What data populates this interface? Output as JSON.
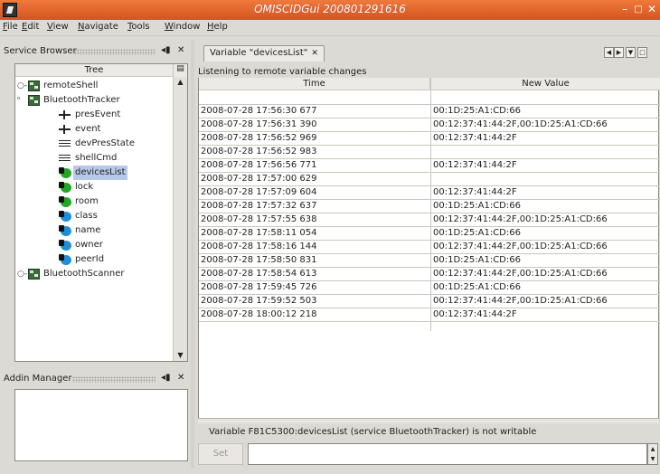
{
  "window": {
    "title": "OMISCIDGui 200801291616"
  },
  "menu": [
    "File",
    "Edit",
    "View",
    "Navigate",
    "Tools",
    "Window",
    "Help"
  ],
  "service_browser": {
    "title": "Service Browser",
    "column": "Tree",
    "pin": "◂▮",
    "close": "✕",
    "items": [
      {
        "label": "remoteShell",
        "type": "service",
        "expanded": false,
        "indent": 0
      },
      {
        "label": "BluetoothTracker",
        "type": "service",
        "expanded": true,
        "indent": 0
      },
      {
        "label": "presEvent",
        "type": "event",
        "indent": 1
      },
      {
        "label": "event",
        "type": "event",
        "indent": 1
      },
      {
        "label": "devPresState",
        "type": "command",
        "indent": 1
      },
      {
        "label": "shellCmd",
        "type": "command",
        "indent": 1
      },
      {
        "label": "devicesList",
        "type": "variable",
        "color": "#22a722",
        "indent": 1,
        "selected": true
      },
      {
        "label": "lock",
        "type": "variable",
        "color": "#22a722",
        "indent": 1
      },
      {
        "label": "room",
        "type": "variable",
        "color": "#22a722",
        "indent": 1
      },
      {
        "label": "class",
        "type": "variable",
        "color": "#1e8fd8",
        "indent": 1
      },
      {
        "label": "name",
        "type": "variable",
        "color": "#1e8fd8",
        "indent": 1
      },
      {
        "label": "owner",
        "type": "variable",
        "color": "#1e8fd8",
        "indent": 1
      },
      {
        "label": "peerId",
        "type": "variable",
        "color": "#1e8fd8",
        "indent": 1
      },
      {
        "label": "BluetoothScanner",
        "type": "service",
        "expanded": false,
        "indent": 0
      }
    ]
  },
  "addin_manager": {
    "title": "Addin Manager",
    "pin": "◂▮",
    "close": "✕"
  },
  "tab": {
    "label": "Variable \"devicesList\"",
    "close": "✕"
  },
  "listening_label": "Listening to remote variable changes",
  "table": {
    "columns": [
      "Time",
      "New Value"
    ],
    "rows": [
      [
        "",
        ""
      ],
      [
        "2008-07-28 17:56:30 677",
        "00:1D:25:A1:CD:66"
      ],
      [
        "2008-07-28 17:56:31 390",
        "00:12:37:41:44:2F,00:1D:25:A1:CD:66"
      ],
      [
        "2008-07-28 17:56:52 969",
        "00:12:37:41:44:2F"
      ],
      [
        "2008-07-28 17:56:52 983",
        ""
      ],
      [
        "2008-07-28 17:56:56 771",
        "00:12:37:41:44:2F"
      ],
      [
        "2008-07-28 17:57:00 629",
        ""
      ],
      [
        "2008-07-28 17:57:09 604",
        "00:12:37:41:44:2F"
      ],
      [
        "2008-07-28 17:57:32 637",
        "00:1D:25:A1:CD:66"
      ],
      [
        "2008-07-28 17:57:55 638",
        "00:12:37:41:44:2F,00:1D:25:A1:CD:66"
      ],
      [
        "2008-07-28 17:58:11 054",
        "00:1D:25:A1:CD:66"
      ],
      [
        "2008-07-28 17:58:16 144",
        "00:12:37:41:44:2F,00:1D:25:A1:CD:66"
      ],
      [
        "2008-07-28 17:58:50 831",
        "00:1D:25:A1:CD:66"
      ],
      [
        "2008-07-28 17:58:54 613",
        "00:12:37:41:44:2F,00:1D:25:A1:CD:66"
      ],
      [
        "2008-07-28 17:59:45 726",
        "00:1D:25:A1:CD:66"
      ],
      [
        "2008-07-28 17:59:52 503",
        "00:12:37:41:44:2F,00:1D:25:A1:CD:66"
      ],
      [
        "2008-07-28 18:00:12 218",
        "00:12:37:41:44:2F"
      ]
    ]
  },
  "status": "Variable F81C5300:devicesList (service BluetoothTracker) is not writable",
  "set_button": "Set",
  "set_input_value": "",
  "colors": {
    "titlebar": "#e06a30",
    "selection": "#b8c8e8",
    "variable_green": "#22a722",
    "variable_blue": "#1e8fd8"
  }
}
